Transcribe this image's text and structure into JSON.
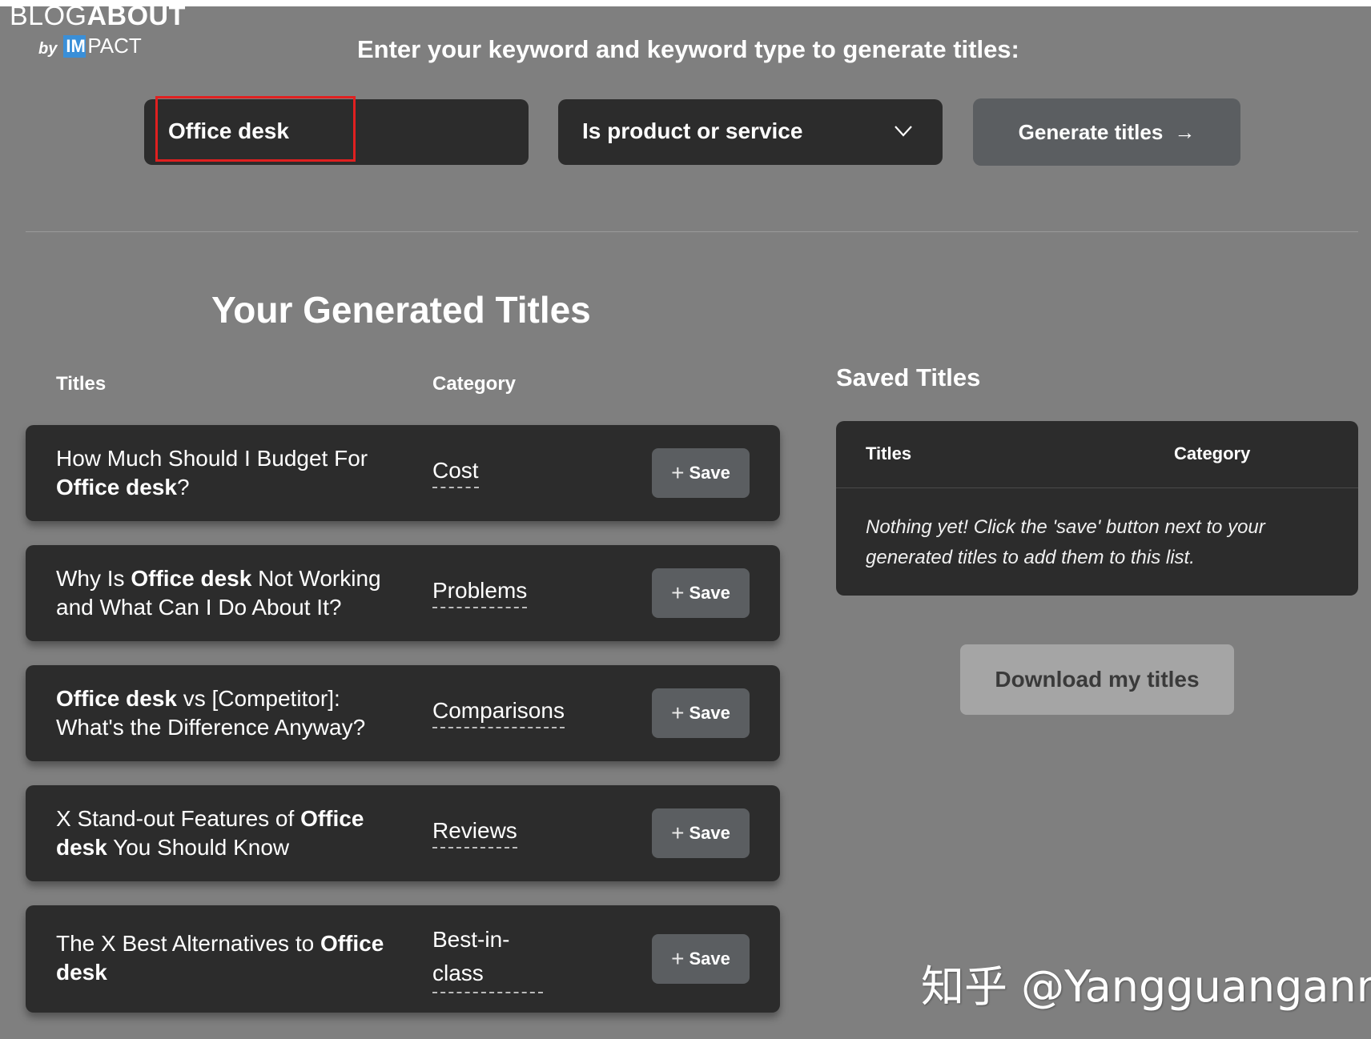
{
  "logo": {
    "blog": "BLOG",
    "about": "ABOUT",
    "by": "by",
    "mark": "IM",
    "impact": "PACT"
  },
  "instructions": "Enter your keyword and keyword type to generate titles:",
  "keyword_input": {
    "value": "Office desk"
  },
  "keyword_type": {
    "selected": "Is product or service"
  },
  "generate_button": {
    "label": "Generate titles",
    "arrow": "→"
  },
  "generated": {
    "heading": "Your Generated Titles",
    "columns": {
      "titles": "Titles",
      "category": "Category"
    },
    "save_label": "Save",
    "save_plus": "+",
    "rows": [
      {
        "pre": "How Much Should I Budget For ",
        "kw": "Office desk",
        "post": "?",
        "category": "Cost"
      },
      {
        "pre": "Why Is ",
        "kw": "Office desk",
        "post": " Not Working and What Can I Do About It?",
        "category": "Problems"
      },
      {
        "pre": "",
        "kw": "Office desk",
        "post": " vs [Competitor]: What's the Difference Anyway?",
        "category": "Comparisons"
      },
      {
        "pre": "X Stand-out Features of ",
        "kw": "Office desk",
        "post": " You Should Know",
        "category": "Reviews"
      },
      {
        "pre": "The X Best Alternatives to ",
        "kw": "Office desk",
        "post": "",
        "category": "Best-in-class"
      }
    ]
  },
  "saved": {
    "heading": "Saved Titles",
    "columns": {
      "titles": "Titles",
      "category": "Category"
    },
    "empty_message": "Nothing yet! Click the 'save' button next to your generated titles to add them to this list."
  },
  "download_button": {
    "label": "Download my titles"
  },
  "watermark": "知乎 @Yangguangann",
  "colors": {
    "background": "#7f7f7f",
    "panel": "#2c2c2c",
    "button": "#5b5e61",
    "highlight": "#e02020"
  }
}
